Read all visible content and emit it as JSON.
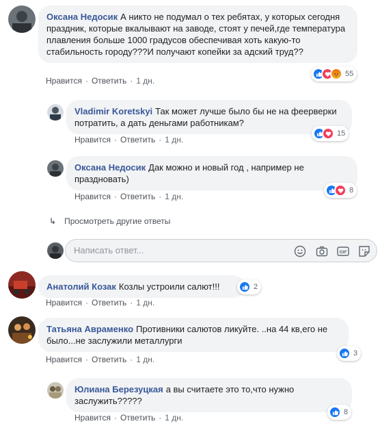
{
  "actions": {
    "like": "Нравится",
    "reply": "Ответить",
    "sep": "·"
  },
  "comments": [
    {
      "author": "Оксана Недосик",
      "text": "А никто не подумал о тех ребятах, у которых сегодня праздник, которые вкалывают на заводе, стоят у печей,где температура плавления больше 1000 градусов обеспечивая хоть какую-то стабильность городу???И получают копейки за адский труд??",
      "time": "1 дн.",
      "reactions": "55",
      "reaction_types": [
        "like",
        "love",
        "angry"
      ]
    },
    {
      "author": "Vladimir Koretskyi",
      "text": "Так может лучше было бы не на феерверки потратить, а дать деньгами работникам?",
      "time": "1 дн.",
      "reactions": "15",
      "reaction_types": [
        "like",
        "love"
      ]
    },
    {
      "author": "Оксана Недосик",
      "text": "Дак можно и новый год , например не праздновать)",
      "time": "1 дн.",
      "reactions": "8",
      "reaction_types": [
        "like",
        "love"
      ]
    },
    {
      "author": "Анатолий Козак",
      "text": "Козлы устроили салют!!!",
      "time": "1 дн.",
      "reactions": "2",
      "reaction_types": [
        "like"
      ]
    },
    {
      "author": "Татьяна Авраменко",
      "text": "Противники салютов ликуйте. ..на 44 кв,его не было...не заслужили металлурги",
      "time": "1 дн.",
      "reactions": "3",
      "reaction_types": [
        "like"
      ]
    },
    {
      "author": "Юлиана Березуцкая",
      "text": "а вы считаете это то,что нужно заслужить?????",
      "time": "1 дн.",
      "reactions": "8",
      "reaction_types": [
        "like"
      ]
    }
  ],
  "more_replies": "Просмотреть другие ответы",
  "reply_input": {
    "placeholder": "Написать ответ..."
  },
  "icons": [
    "emoji-icon",
    "camera-icon",
    "gif-icon",
    "sticker-icon"
  ],
  "colors": {
    "name": "#385898",
    "like": "#1877f2",
    "love": "#f33e58",
    "angry": "#f7b125",
    "bubble": "#f2f3f5"
  }
}
